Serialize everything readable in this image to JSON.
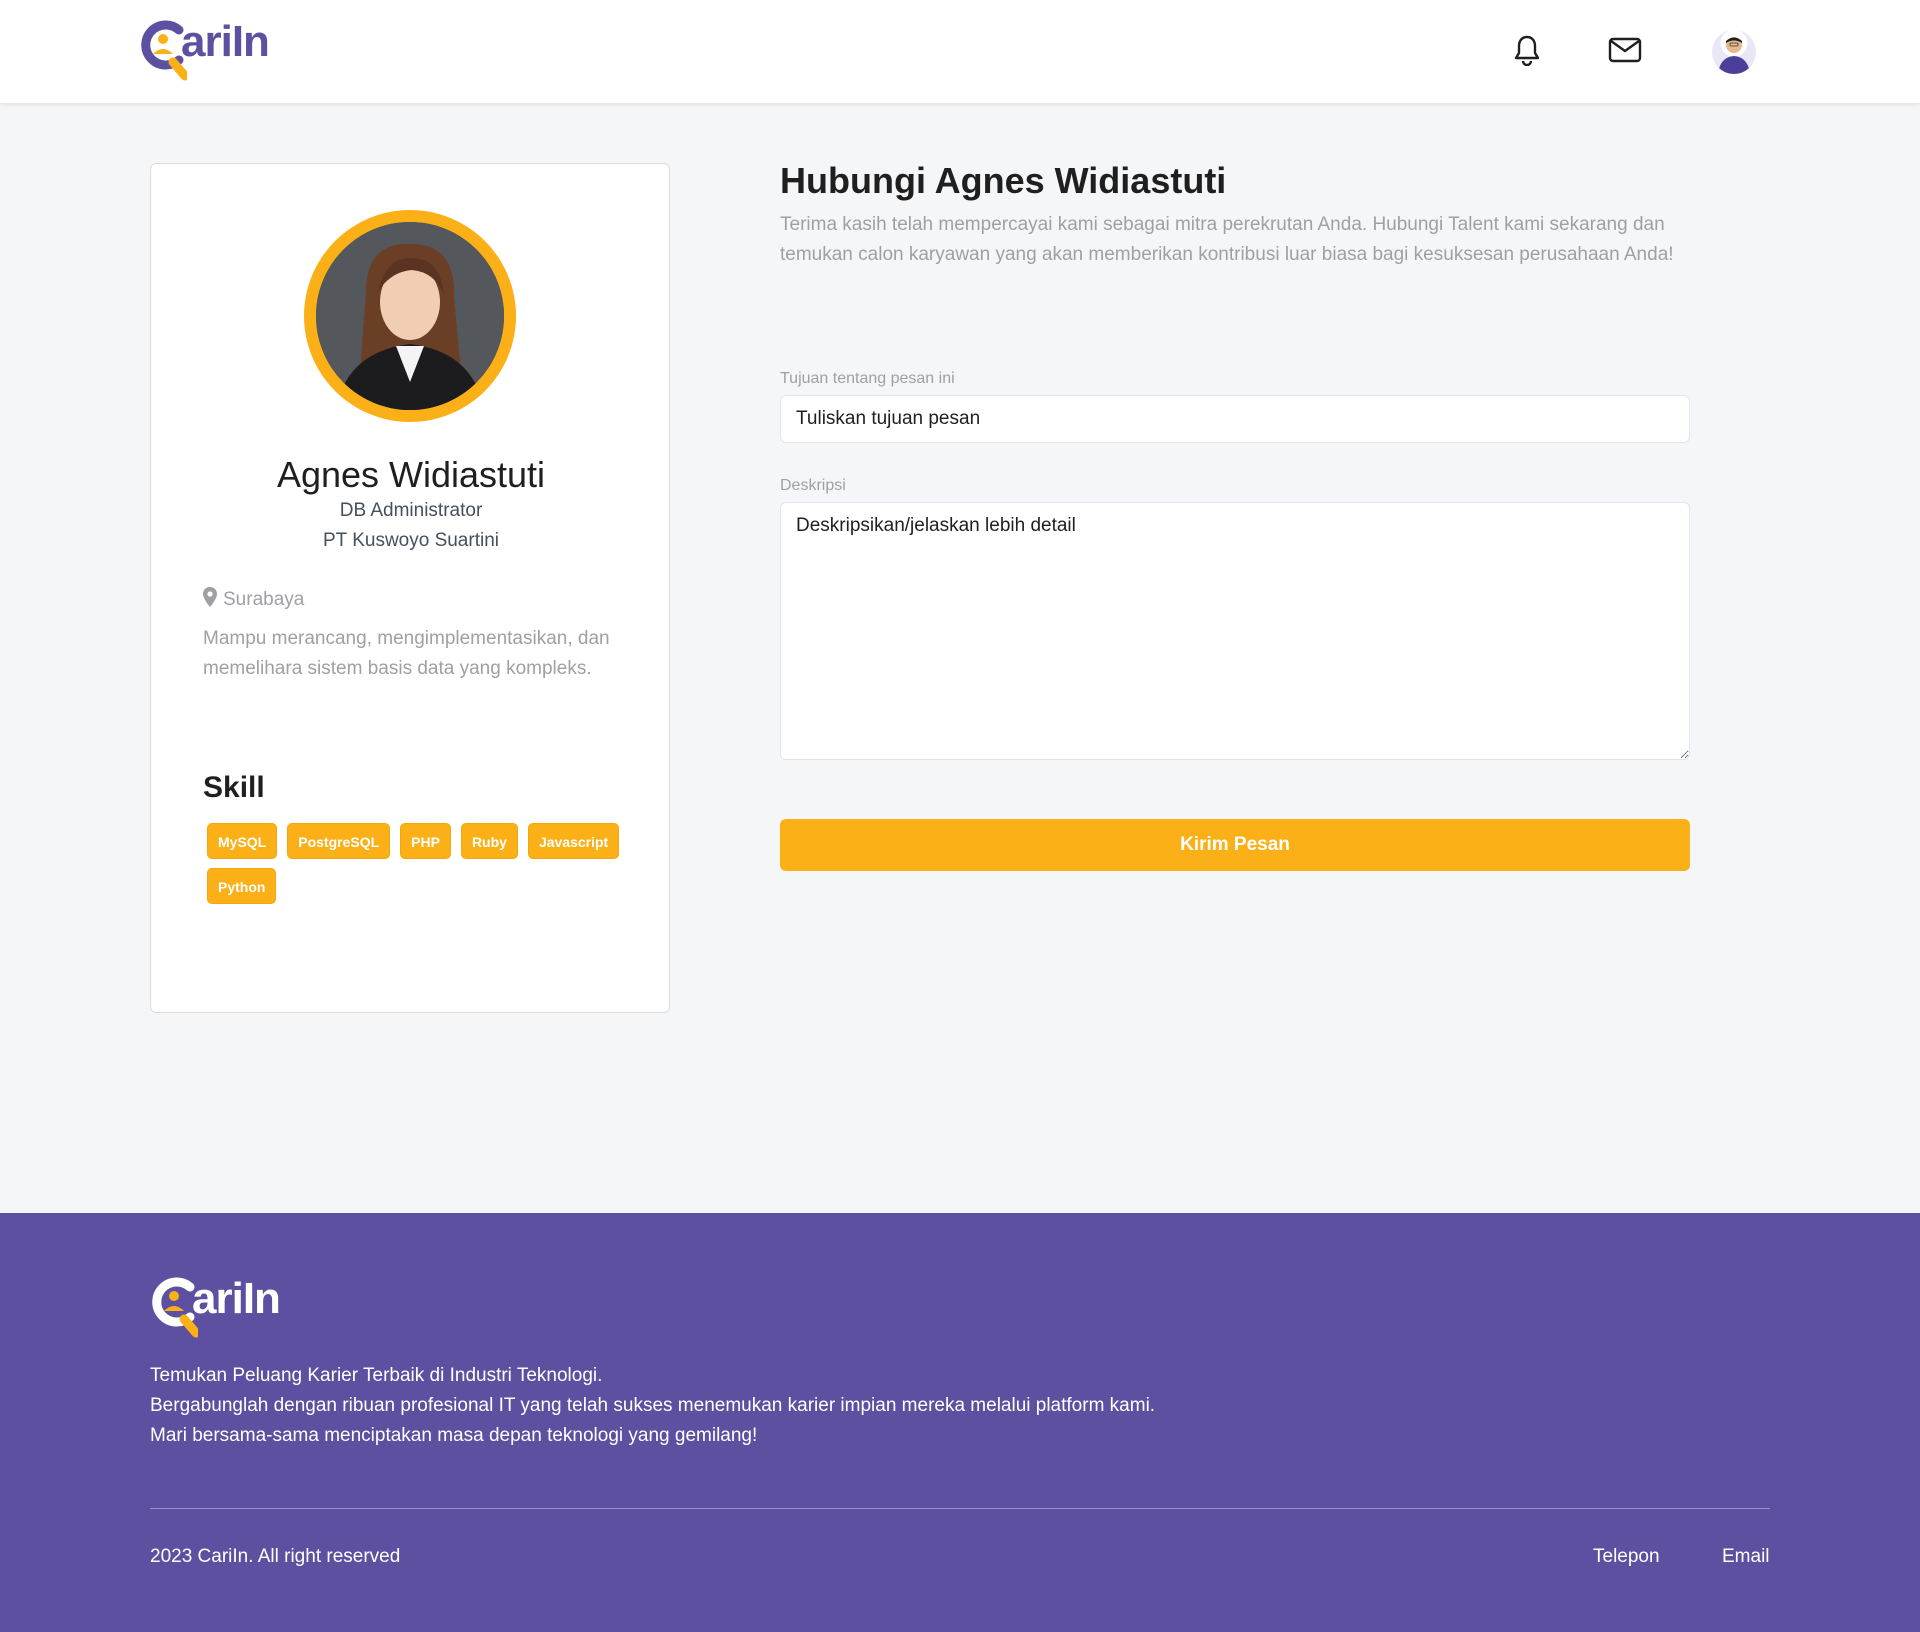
{
  "brand": {
    "name": "CariIn",
    "logo_text": "ariIn"
  },
  "colors": {
    "primary": "#5e50a1",
    "accent": "#fbb017",
    "muted_text": "#9ea0a5",
    "background": "#f5f6f8"
  },
  "navbar": {
    "icons": [
      "bell-icon",
      "mail-icon",
      "user-avatar"
    ]
  },
  "profile": {
    "name": "Agnes Widiastuti",
    "job_title": "DB Administrator",
    "company": "PT Kuswoyo Suartini",
    "location": "Surabaya",
    "bio": "Mampu merancang, mengimplementasikan, dan memelihara sistem basis data yang kompleks.",
    "skill_heading": "Skill",
    "skills": [
      "MySQL",
      "PostgreSQL",
      "PHP",
      "Ruby",
      "Javascript",
      "Python"
    ]
  },
  "contact_form": {
    "title": "Hubungi Agnes Widiastuti",
    "description": "Terima kasih telah mempercayai kami sebagai mitra perekrutan Anda. Hubungi Talent kami sekarang dan temukan calon karyawan yang akan memberikan kontribusi luar biasa bagi kesuksesan perusahaan Anda!",
    "purpose_label": "Tujuan tentang pesan ini",
    "purpose_placeholder": "Tuliskan tujuan pesan",
    "description_label": "Deskripsi",
    "description_placeholder": "Deskripsikan/jelaskan lebih detail",
    "submit_label": "Kirim Pesan"
  },
  "footer": {
    "tagline_line1": "Temukan Peluang Karier Terbaik di Industri Teknologi.",
    "tagline_line2": "Bergabunglah dengan ribuan profesional IT yang telah sukses menemukan karier impian mereka melalui platform kami.",
    "tagline_line3": "Mari bersama-sama menciptakan masa depan teknologi yang gemilang!",
    "copyright": "2023 CariIn. All right reserved",
    "links": {
      "phone": "Telepon",
      "email": "Email"
    }
  }
}
